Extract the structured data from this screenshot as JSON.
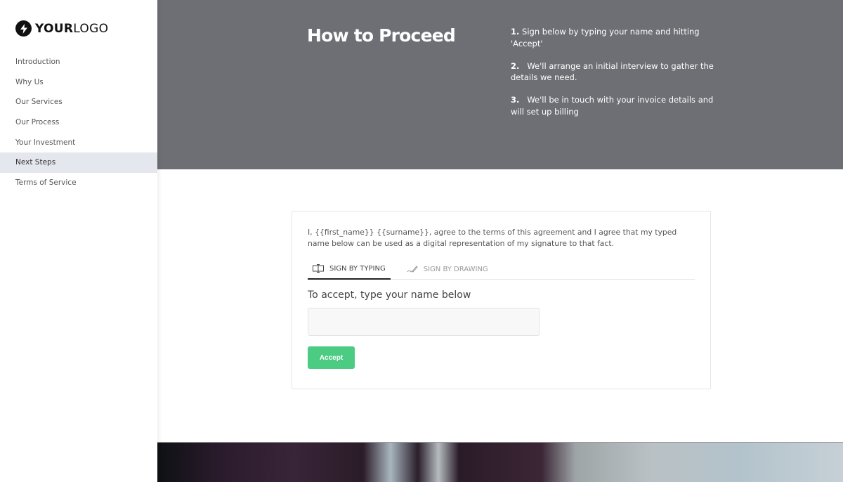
{
  "logo": {
    "bold": "YOUR",
    "light": "LOGO",
    "icon": "lightning-bolt-icon"
  },
  "sidebar": {
    "items": [
      {
        "label": "Introduction",
        "active": false
      },
      {
        "label": "Why Us",
        "active": false
      },
      {
        "label": "Our Services",
        "active": false
      },
      {
        "label": "Our Process",
        "active": false
      },
      {
        "label": "Your Investment",
        "active": false
      },
      {
        "label": "Next Steps",
        "active": true
      },
      {
        "label": "Terms of Service",
        "active": false
      }
    ]
  },
  "hero": {
    "title": "How to Proceed",
    "steps": [
      {
        "num": "1.",
        "text": "Sign below by typing your name and hitting 'Accept'"
      },
      {
        "num": "2.",
        "text": "We'll arrange an initial interview to gather the details we need."
      },
      {
        "num": "3.",
        "text": "We'll be in touch with your invoice details and will set up billing"
      }
    ]
  },
  "signature": {
    "agreement": "I, {{first_name}} {{surname}}, agree to the terms of this agreement and I agree that my typed name below can be used as a digital representation of my signature to that fact.",
    "tabs": [
      {
        "label": "SIGN BY TYPING",
        "icon": "text-cursor-icon",
        "active": true
      },
      {
        "label": "SIGN BY DRAWING",
        "icon": "pen-icon",
        "active": false
      }
    ],
    "prompt": "To accept, type your name below",
    "input_value": "",
    "accept_label": "Accept"
  },
  "colors": {
    "hero_bg": "#6e6f74",
    "accept_green": "#4ccb82",
    "active_nav": "#e4e7ee"
  }
}
